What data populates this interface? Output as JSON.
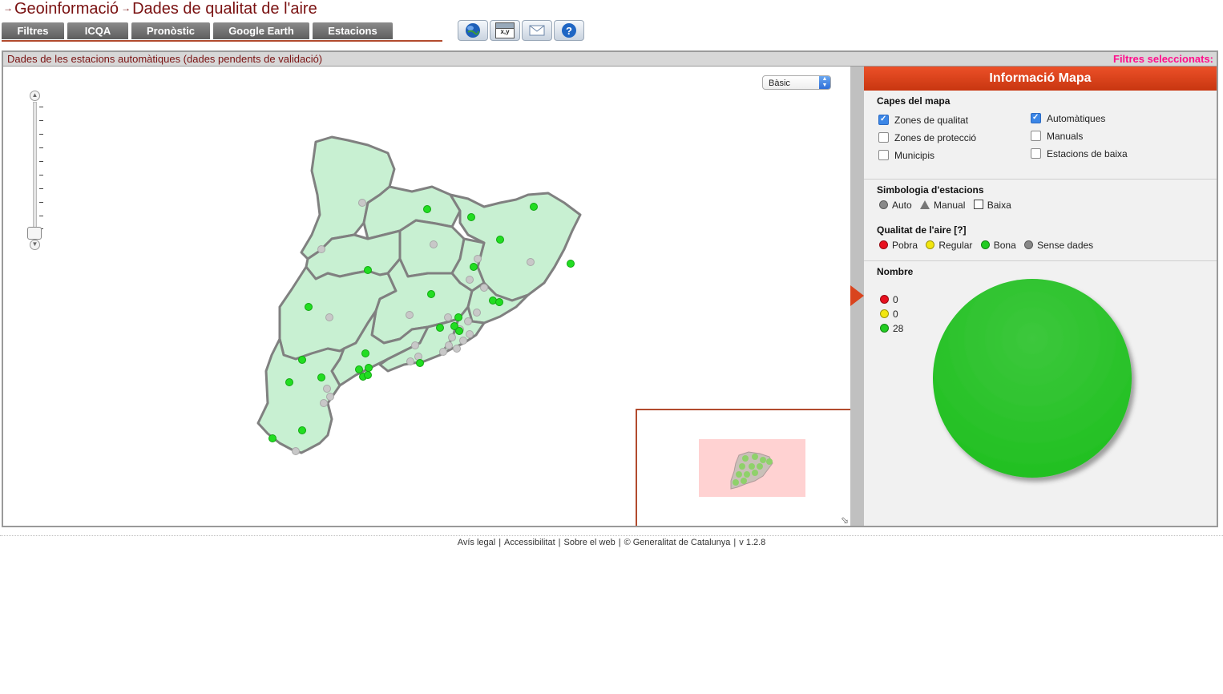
{
  "header": {
    "crumbs": [
      "Geoinformació",
      "Dades de qualitat de l'aire"
    ],
    "tabs": [
      "Filtres",
      "ICQA",
      "Pronòstic",
      "Google Earth",
      "Estacions"
    ],
    "tool_icons": [
      "globe-icon",
      "xy-coordinates-icon",
      "mail-icon",
      "help-icon"
    ],
    "xy_label": "x,y"
  },
  "main": {
    "title": "Dades de les estacions automàtiques (dades pendents de validació)",
    "filters_label": "Filtres seleccionats:",
    "basemap_select": "Bàsic"
  },
  "panel": {
    "title": "Informació Mapa",
    "layers_title": "Capes del mapa",
    "layers_left": [
      {
        "label": "Zones de qualitat",
        "checked": true
      },
      {
        "label": "Zones de protecció",
        "checked": false
      },
      {
        "label": "Municipis",
        "checked": false
      }
    ],
    "layers_right": [
      {
        "label": "Automàtiques",
        "checked": true
      },
      {
        "label": "Manuals",
        "checked": false
      },
      {
        "label": "Estacions de baixa",
        "checked": false
      }
    ],
    "symbology_title": "Simbologia d'estacions",
    "symbology": [
      "Auto",
      "Manual",
      "Baixa"
    ],
    "quality_title": "Qualitat de l'aire [?]",
    "quality": [
      {
        "label": "Pobra",
        "color": "#e8101e"
      },
      {
        "label": "Regular",
        "color": "#f2e60f"
      },
      {
        "label": "Bona",
        "color": "#22cc22"
      },
      {
        "label": "Sense dades",
        "color": "#888888"
      }
    ],
    "count_title": "Nombre",
    "counts": [
      {
        "value": "0",
        "color": "#e8101e"
      },
      {
        "value": "0",
        "color": "#f2e60f"
      },
      {
        "value": "28",
        "color": "#22cc22"
      }
    ]
  },
  "chart_data": {
    "type": "pie",
    "categories": [
      "Pobra",
      "Regular",
      "Bona"
    ],
    "values": [
      0,
      0,
      28
    ],
    "colors": [
      "#e8101e",
      "#f2e60f",
      "#22c022"
    ]
  },
  "footer": {
    "links": [
      "Avís legal",
      "Accessibilitat",
      "Sobre el web",
      "© Generalitat de Catalunya",
      "v 1.2.8"
    ]
  },
  "colors": {
    "region_fill": "#c8f0d2",
    "region_stroke": "#808080",
    "station_good": "#22dd22",
    "station_nodata": "#c8c8c8"
  }
}
